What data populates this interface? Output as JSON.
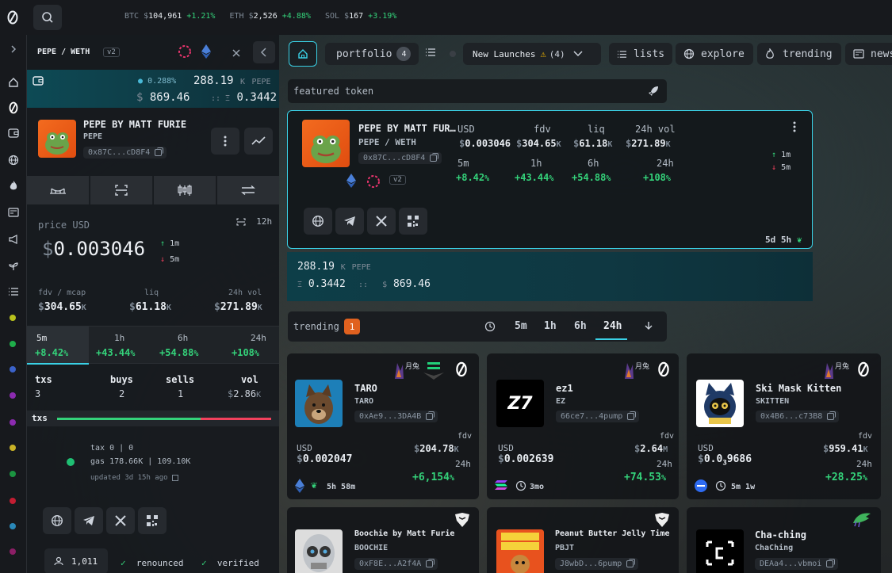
{
  "topbar": {
    "tickers": [
      {
        "sym": "BTC",
        "price": "104,961",
        "change": "+1.21%"
      },
      {
        "sym": "ETH",
        "price": "2,526",
        "change": "+4.88%"
      },
      {
        "sym": "SOL",
        "price": "167",
        "change": "+3.19%"
      }
    ]
  },
  "panel": {
    "pair": "PEPE / WETH",
    "version": "v2",
    "balance": {
      "pct": "0.288%",
      "amount": "288.19",
      "amount_unit": "K",
      "token": "PEPE",
      "usd": "869.46",
      "eth": "0.3442"
    },
    "token": {
      "name": "PEPE BY MATT FURIE",
      "symbol": "PEPE",
      "address": "0x87C...cD8F4"
    },
    "price_label": "price USD",
    "timeframe": "12h",
    "price": "0.003046",
    "arrows": {
      "up": "1m",
      "down": "5m"
    },
    "stats": [
      {
        "label": "fdv / mcap",
        "value": "304.65",
        "unit": "K"
      },
      {
        "label": "liq",
        "value": "61.18",
        "unit": "K"
      },
      {
        "label": "24h vol",
        "value": "271.89",
        "unit": "K"
      }
    ],
    "changes": [
      {
        "tf": "5m",
        "value": "+8.42"
      },
      {
        "tf": "1h",
        "value": "+43.44"
      },
      {
        "tf": "6h",
        "value": "+54.88"
      },
      {
        "tf": "24h",
        "value": "+108"
      }
    ],
    "tx_headers": [
      "txs",
      "buys",
      "sells",
      "vol"
    ],
    "tx_values": [
      "3",
      "2",
      "1",
      "2.86"
    ],
    "tx_vol_unit": "K",
    "tx_bar_label": "txs",
    "tx_buy_ratio": 0.67,
    "tax": "tax 0 | 0",
    "gas": "gas 178.66K | 109.10K",
    "updated": "updated 3d 15h ago",
    "holders": "1,011",
    "renounced": "renounced",
    "verified": "verified"
  },
  "main": {
    "portfolio_label": "portfolio",
    "portfolio_count": "4",
    "new_launches_label": "New Launches",
    "new_launches_count": "(4)",
    "nav": [
      "lists",
      "explore",
      "trending",
      "news"
    ],
    "featured_label": "featured token",
    "featured": {
      "name": "PEPE BY MATT FUR…",
      "pair": "PEPE / WETH",
      "address": "0x87C...cD8F4",
      "version": "v2",
      "usd_label": "USD",
      "price": "0.003046",
      "metrics": [
        {
          "label": "fdv",
          "value": "304.65",
          "unit": "K"
        },
        {
          "label": "liq",
          "value": "61.18",
          "unit": "K"
        },
        {
          "label": "24h vol",
          "value": "271.89",
          "unit": "K"
        }
      ],
      "changes": [
        {
          "tf": "5m",
          "value": "+8.42"
        },
        {
          "tf": "1h",
          "value": "+43.44"
        },
        {
          "tf": "6h",
          "value": "+54.88"
        },
        {
          "tf": "24h",
          "value": "+108"
        }
      ],
      "up": "1m",
      "down": "5m",
      "age": "5d 5h",
      "balance_amount": "288.19",
      "balance_unit": "K",
      "balance_token": "PEPE",
      "balance_eth": "0.3442",
      "balance_usd": "869.46"
    },
    "trending_label": "trending",
    "trending_count": "1",
    "timeframes": [
      "5m",
      "1h",
      "6h",
      "24h"
    ],
    "cards": [
      {
        "name": "TARO",
        "symbol": "TARO",
        "address": "0xAe9...3DA4B",
        "usd_label": "USD",
        "fdv_label": "fdv",
        "fdv": "204.78",
        "fdv_unit": "K",
        "price": "0.002047",
        "tf": "24h",
        "change": "+6,154",
        "age": "5h 58m"
      },
      {
        "name": "ez1",
        "symbol": "EZ",
        "address": "66ce7...4pump",
        "usd_label": "USD",
        "fdv_label": "fdv",
        "fdv": "2.64",
        "fdv_unit": "M",
        "price": "0.002639",
        "tf": "24h",
        "change": "+74.53",
        "age": "3mo"
      },
      {
        "name": "Ski Mask Kitten",
        "symbol": "SKITTEN",
        "address": "0x4B6...c73B8",
        "usd_label": "USD",
        "fdv_label": "fdv",
        "fdv": "959.41",
        "fdv_unit": "K",
        "price_pre": "0.0",
        "price_sub": "3",
        "price_post": "9686",
        "tf": "24h",
        "change": "+28.25",
        "age": "5m 1w"
      },
      {
        "name": "Boochie by Matt Furie",
        "symbol": "BOOCHIE",
        "address": "0xF8E...A2f4A"
      },
      {
        "name": "Peanut Butter Jelly Time",
        "symbol": "PBJT",
        "address": "J8wbD...6pump"
      },
      {
        "name": "Cha-ching",
        "symbol": "ChaChing",
        "address": "DEAa4...vbmoi"
      }
    ]
  },
  "colors": {
    "green": "#34d27a",
    "red": "#f2415d",
    "accent": "#3ad1e6",
    "orange": "#e0611f"
  }
}
